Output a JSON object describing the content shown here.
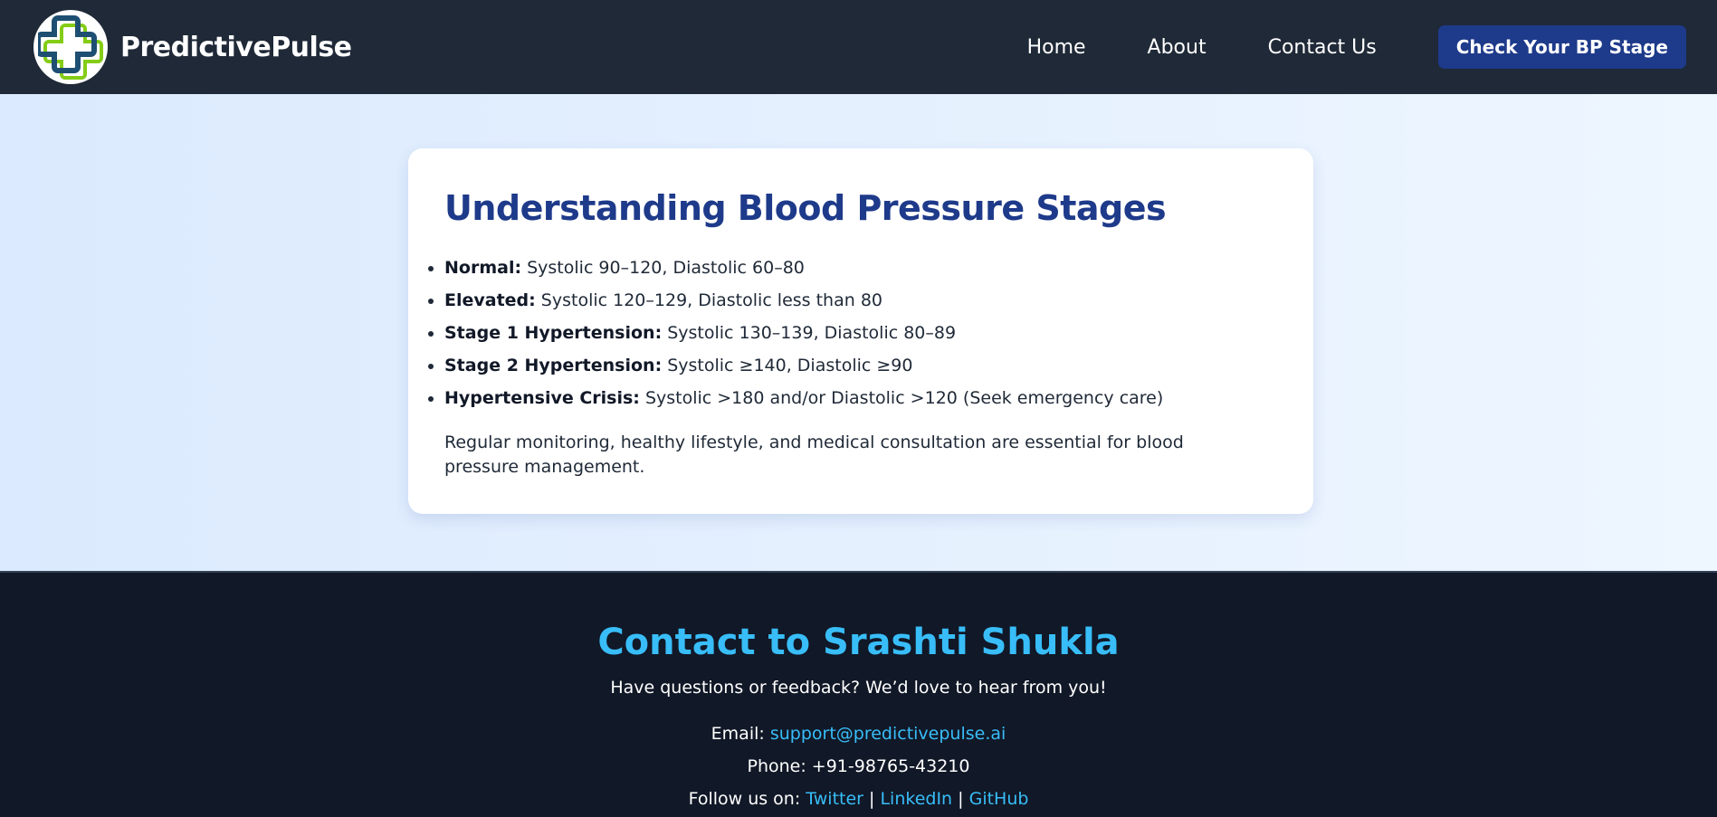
{
  "brand": {
    "name": "PredictivePulse",
    "logo_icon": "medical-cross-icon",
    "logo_colors": {
      "primary": "#1e4f72",
      "accent": "#84cc16"
    }
  },
  "nav": {
    "links": [
      "Home",
      "About",
      "Contact Us"
    ],
    "cta": "Check Your BP Stage"
  },
  "card": {
    "title": "Understanding Blood Pressure Stages",
    "stages": [
      {
        "label": "Normal:",
        "text": " Systolic 90–120, Diastolic 60–80"
      },
      {
        "label": "Elevated:",
        "text": " Systolic 120–129, Diastolic less than 80"
      },
      {
        "label": "Stage 1 Hypertension:",
        "text": " Systolic 130–139, Diastolic 80–89"
      },
      {
        "label": "Stage 2 Hypertension:",
        "text": " Systolic ≥140, Diastolic ≥90"
      },
      {
        "label": "Hypertensive Crisis:",
        "text": " Systolic >180 and/or Diastolic >120 (Seek emergency care)"
      }
    ],
    "note": "Regular monitoring, healthy lifestyle, and medical consultation are essential for blood pressure management."
  },
  "footer": {
    "title": "Contact to Srashti Shukla",
    "tagline": "Have questions or feedback? We’d love to hear from you!",
    "email_label": "Email: ",
    "email": "support@predictivepulse.ai",
    "phone": "Phone: +91-98765-43210",
    "follow_label": "Follow us on: ",
    "social": [
      "Twitter",
      "LinkedIn",
      "GitHub"
    ],
    "separator": " | "
  },
  "colors": {
    "nav_bg": "#1f2937",
    "accent_blue": "#1e3a8a",
    "link_blue": "#38bdf8",
    "footer_bg": "#111827"
  }
}
